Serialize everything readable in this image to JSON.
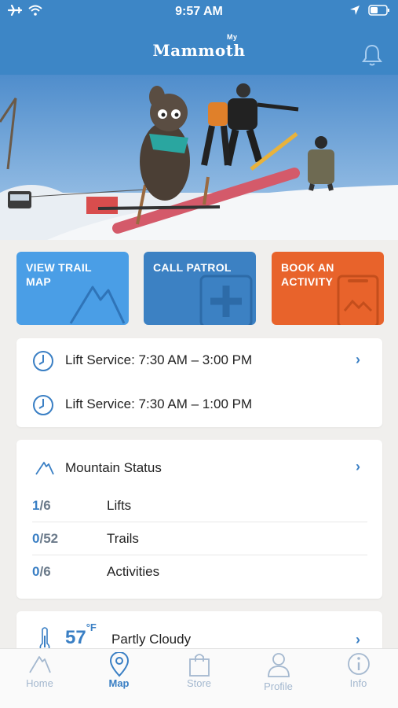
{
  "status_bar": {
    "time": "9:57 AM"
  },
  "header": {
    "brand": "Mammoth",
    "brand_sup": "My"
  },
  "tiles": [
    {
      "label": "VIEW TRAIL MAP",
      "color": "#4a9ee6",
      "icon": "mountain-icon"
    },
    {
      "label": "CALL PATROL",
      "color": "#3c81c3",
      "icon": "first-aid-icon"
    },
    {
      "label": "BOOK AN ACTIVITY",
      "color": "#e8632b",
      "icon": "ticket-icon"
    }
  ],
  "lift_service": [
    {
      "text": "Lift Service: 7:30 AM – 3:00 PM"
    },
    {
      "text": "Lift Service: 7:30 AM – 1:00 PM"
    }
  ],
  "mountain_status": {
    "title": "Mountain Status",
    "rows": [
      {
        "open": "1",
        "total": "/6",
        "label": "Lifts"
      },
      {
        "open": "0",
        "total": "/52",
        "label": "Trails"
      },
      {
        "open": "0",
        "total": "/6",
        "label": "Activities"
      }
    ]
  },
  "weather": {
    "temp": "57",
    "unit": "°F",
    "desc": "Partly Cloudy"
  },
  "tabs": [
    {
      "label": "Home",
      "icon": "home-icon"
    },
    {
      "label": "Map",
      "icon": "map-pin-icon",
      "active": true
    },
    {
      "label": "Store",
      "icon": "shopping-bag-icon"
    },
    {
      "label": "Profile",
      "icon": "profile-icon"
    },
    {
      "label": "Info",
      "icon": "info-icon"
    }
  ],
  "colors": {
    "header_blue": "#3d86c6",
    "accent": "#3a7fc4",
    "orange": "#e8632b"
  }
}
